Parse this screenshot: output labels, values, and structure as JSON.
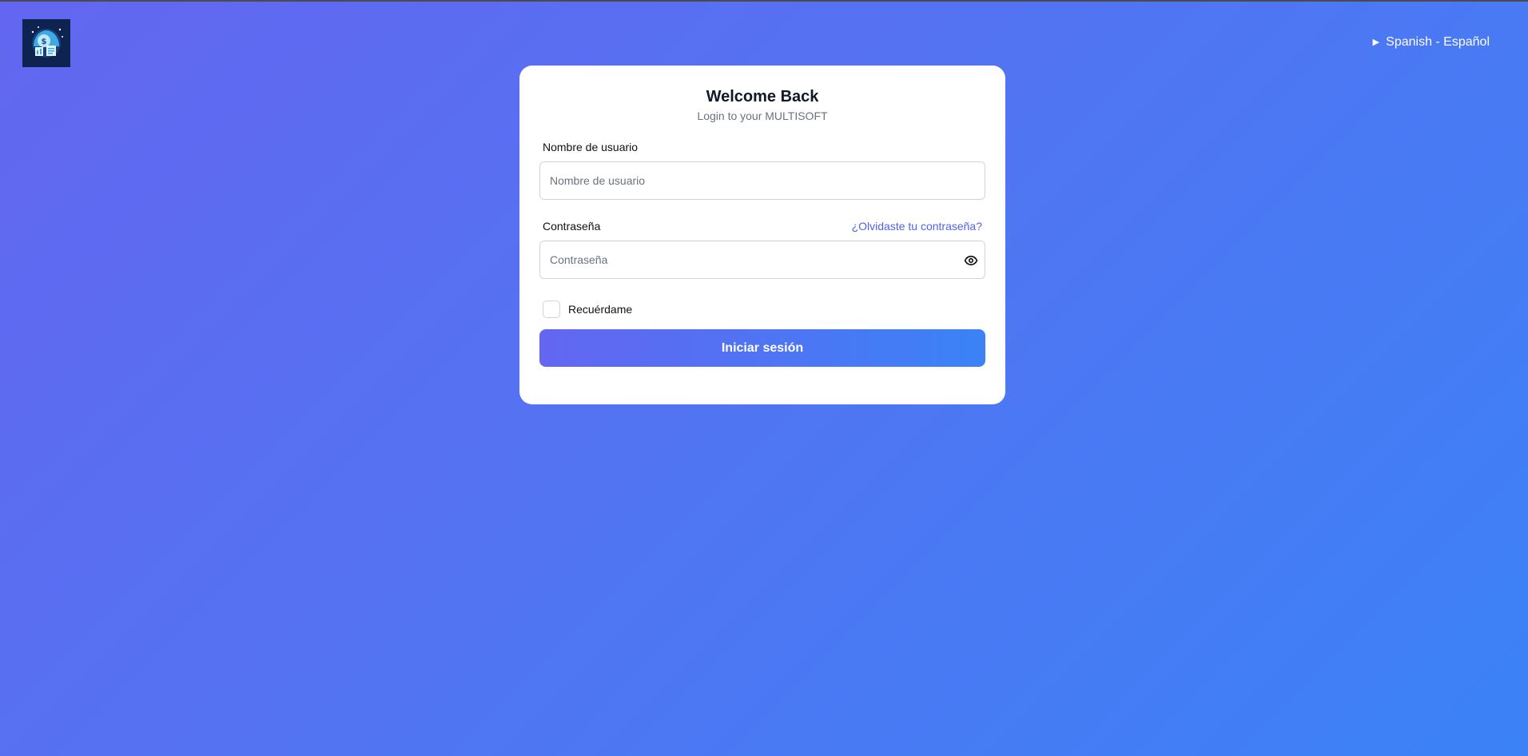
{
  "header": {
    "logo_icon": "multisoft-logo-icon",
    "language": {
      "caret_icon": "triangle-right-icon",
      "label": "Spanish - Español"
    }
  },
  "login": {
    "title": "Welcome Back",
    "subtitle": "Login to your MULTISOFT",
    "username": {
      "label": "Nombre de usuario",
      "placeholder": "Nombre de usuario",
      "value": ""
    },
    "password": {
      "label": "Contraseña",
      "placeholder": "Contraseña",
      "value": "",
      "forgot_link": "¿Olvidaste tu contraseña?",
      "toggle_icon": "eye-icon"
    },
    "remember": {
      "label": "Recuérdame",
      "checked": false
    },
    "submit_label": "Iniciar sesión"
  },
  "colors": {
    "background_start": "#6366f0",
    "background_end": "#3b82f6",
    "button_start": "#6366f1",
    "button_end": "#3b82f6",
    "link": "#4f63ea",
    "card": "#ffffff"
  }
}
